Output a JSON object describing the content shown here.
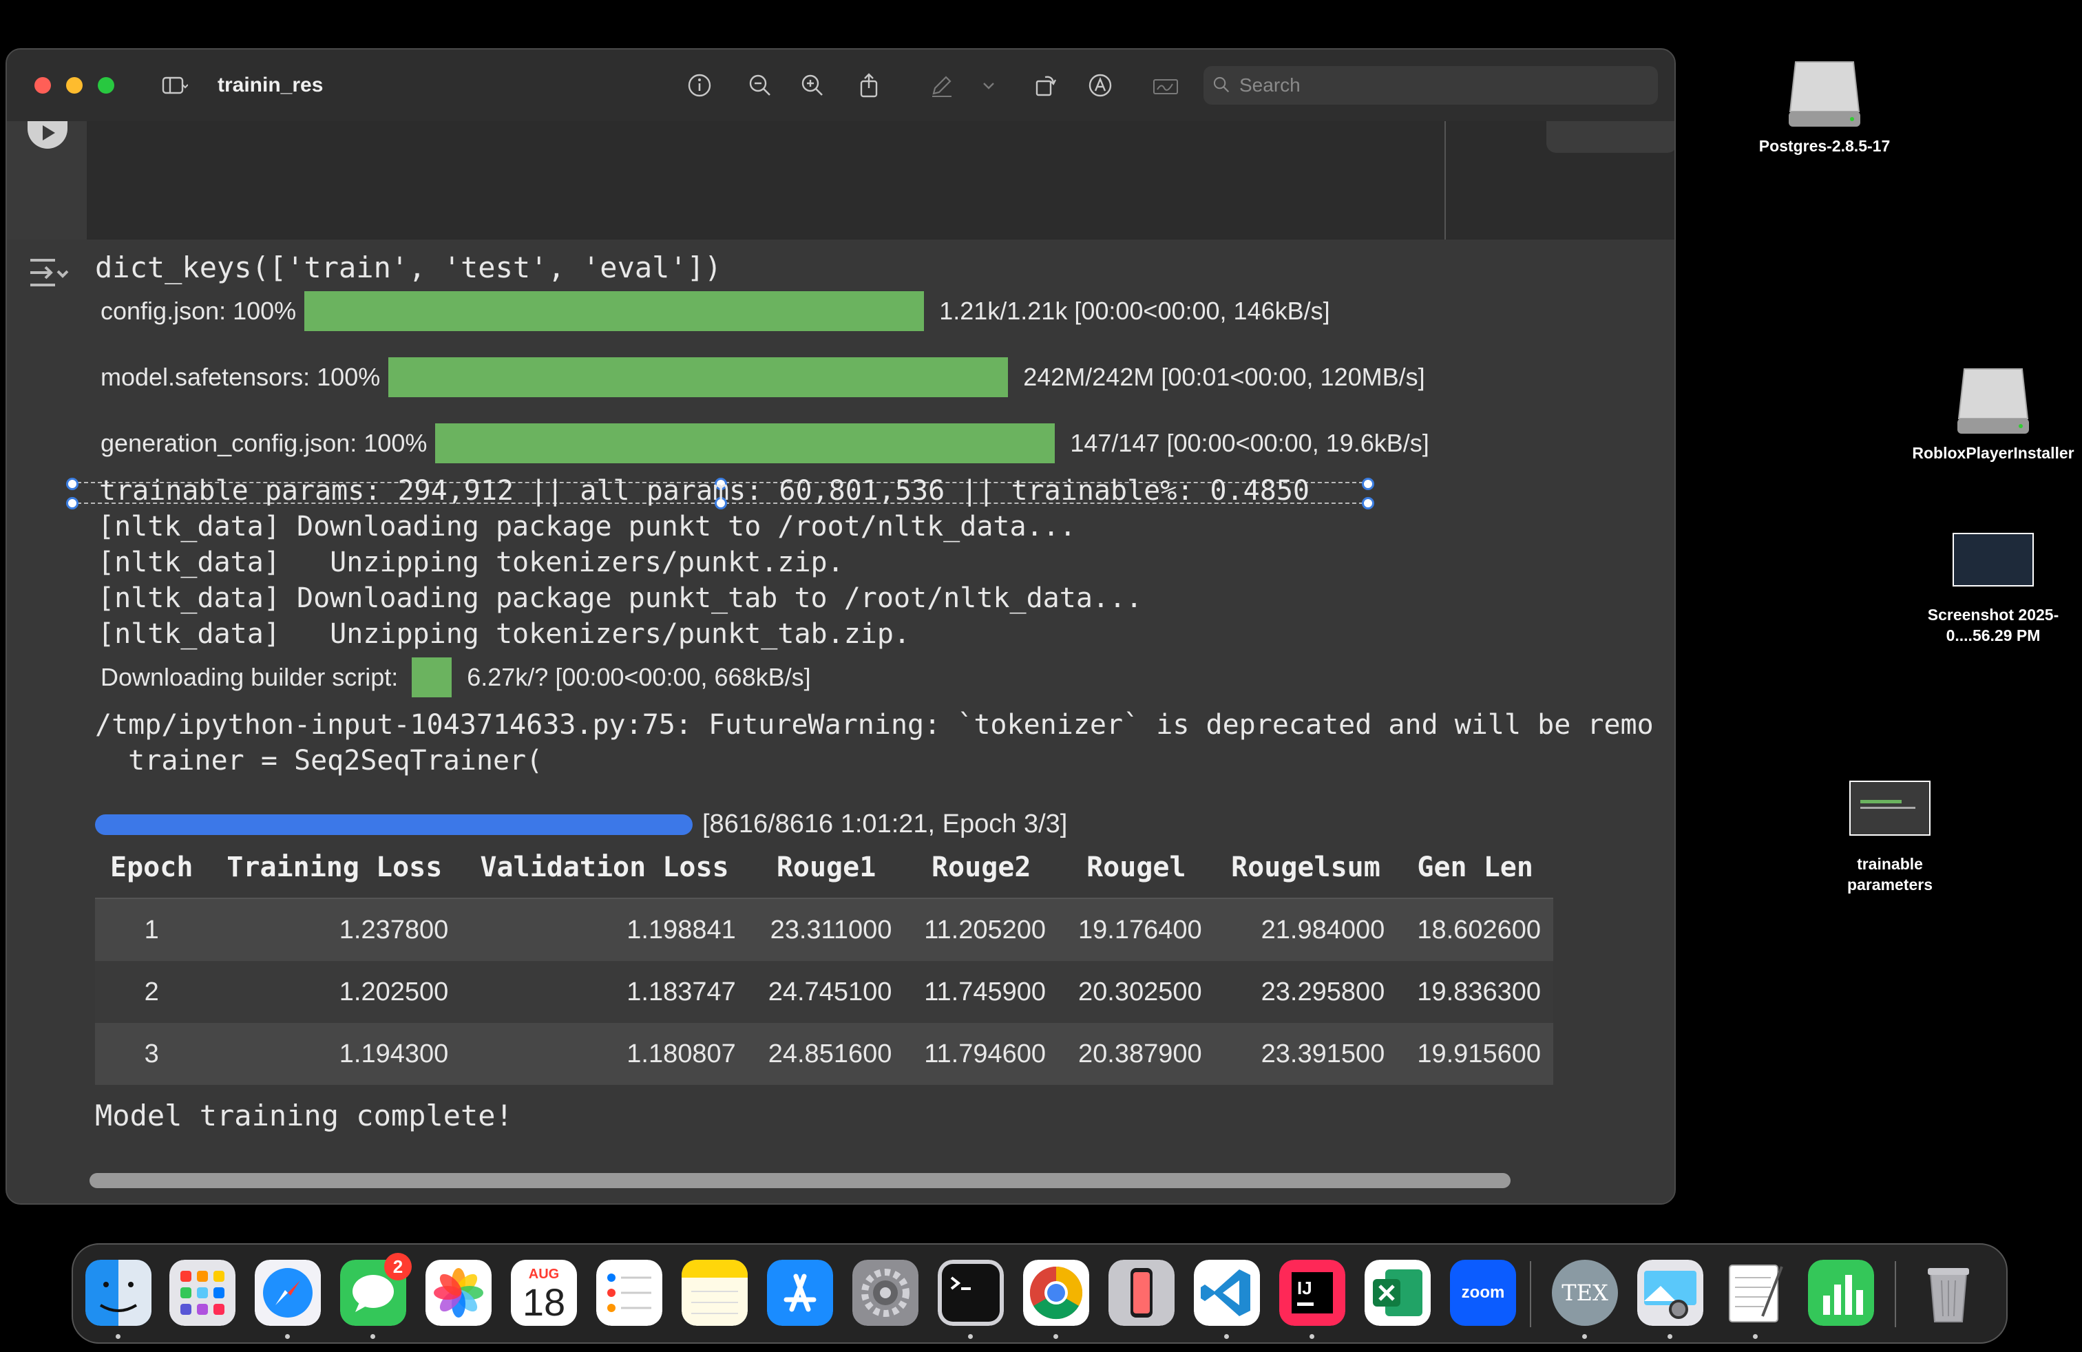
{
  "window": {
    "title": "trainin_res",
    "search_placeholder": "Search"
  },
  "output": {
    "dict_keys": "dict_keys(['train', 'test', 'eval'])",
    "downloads": [
      {
        "label": "config.json: 100%",
        "stat": "1.21k/1.21k [00:00<00:00, 146kB/s]",
        "progress": 1.0
      },
      {
        "label": "model.safetensors: 100%",
        "stat": "242M/242M [00:01<00:00, 120MB/s]",
        "progress": 1.0
      },
      {
        "label": "generation_config.json: 100%",
        "stat": "147/147 [00:00<00:00, 19.6kB/s]",
        "progress": 1.0
      }
    ],
    "trainable_line": "trainable params: 294,912 || all params: 60,801,536 || trainable%: 0.4850",
    "nltk_lines": [
      "[nltk_data] Downloading package punkt to /root/nltk_data...",
      "[nltk_data]   Unzipping tokenizers/punkt.zip.",
      "[nltk_data] Downloading package punkt_tab to /root/nltk_data...",
      "[nltk_data]   Unzipping tokenizers/punkt_tab.zip."
    ],
    "builder": {
      "label": "Downloading builder script:",
      "stat": "6.27k/? [00:00<00:00, 668kB/s]"
    },
    "warning_lines": [
      "/tmp/ipython-input-1043714633.py:75: FutureWarning: `tokenizer` is deprecated and will be remo",
      "  trainer = Seq2SeqTrainer("
    ],
    "training_progress": {
      "text": "[8616/8616 1:01:21, Epoch 3/3]",
      "progress": 1.0
    },
    "table": {
      "headers": [
        "Epoch",
        "Training Loss",
        "Validation Loss",
        "Rouge1",
        "Rouge2",
        "Rougel",
        "Rougelsum",
        "Gen Len"
      ],
      "rows": [
        [
          "1",
          "1.237800",
          "1.198841",
          "23.311000",
          "11.205200",
          "19.176400",
          "21.984000",
          "18.602600"
        ],
        [
          "2",
          "1.202500",
          "1.183747",
          "24.745100",
          "11.745900",
          "20.302500",
          "23.295800",
          "19.836300"
        ],
        [
          "3",
          "1.194300",
          "1.180807",
          "24.851600",
          "11.794600",
          "20.387900",
          "23.391500",
          "19.915600"
        ]
      ]
    },
    "complete": "Model training complete!"
  },
  "desktop": {
    "icons": [
      {
        "label": "Postgres-2.8.5-17"
      },
      {
        "label": "RobloxPlayerInstaller"
      },
      {
        "label": "Screenshot 2025-0....56.29 PM"
      },
      {
        "label": "trainable parameters"
      }
    ]
  },
  "dock": {
    "messages_badge": "2",
    "calendar_month": "AUG",
    "calendar_day": "18",
    "zoom_label": "zoom",
    "tex_label": "TEX"
  }
}
